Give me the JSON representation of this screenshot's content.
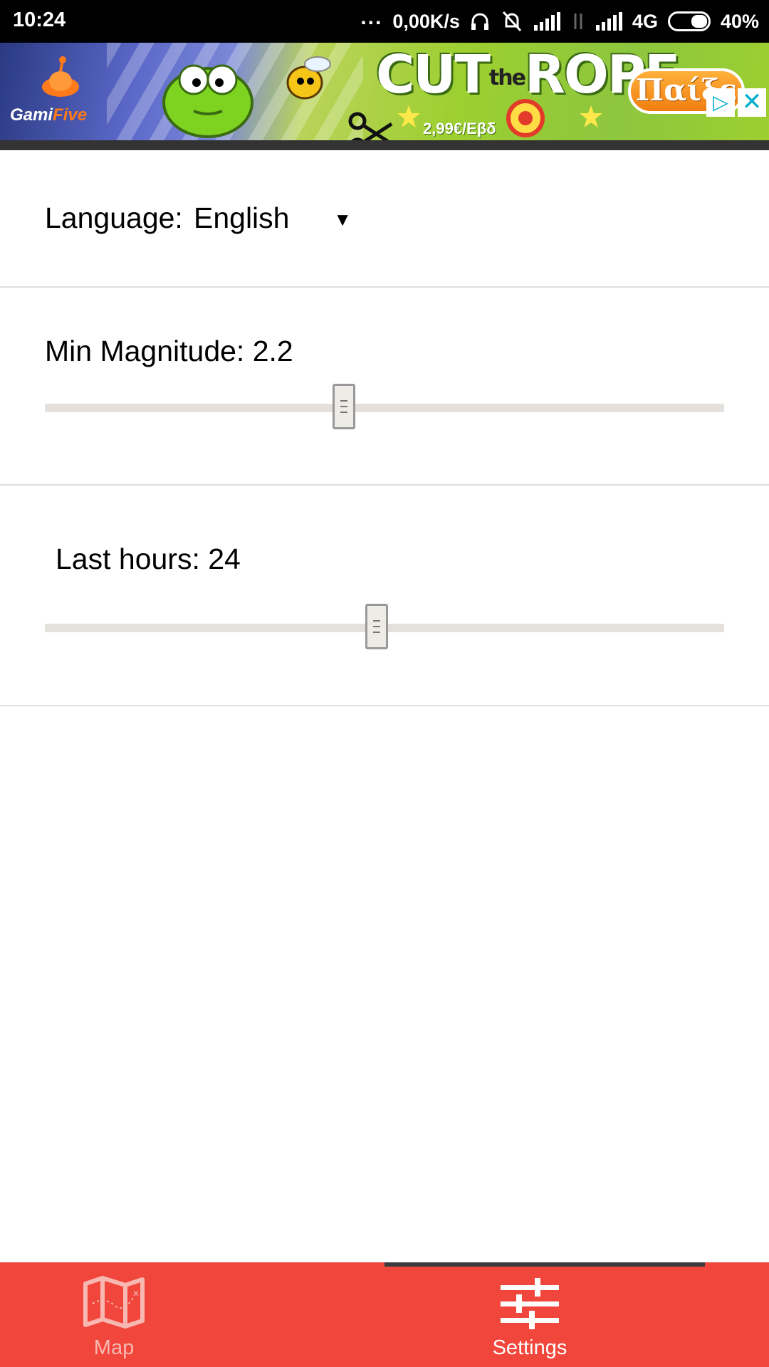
{
  "status_bar": {
    "time": "10:24",
    "dots": "...",
    "network_speed": "0,00K/s",
    "network_type": "4G",
    "battery": "40%",
    "battery_level": 0.4
  },
  "ad": {
    "brand_prefix": "Gami",
    "brand_suffix": "Five",
    "title_left": "CUT",
    "title_the": "the",
    "title_right": "ROPE",
    "price": "2,99€/Εβδ",
    "cta_label": "Παίξε",
    "choices_icon": "ad-choices-icon",
    "close_icon": "close-icon"
  },
  "settings": {
    "language": {
      "label": "Language:",
      "value": "English",
      "arrow": "▼"
    },
    "magnitude": {
      "label": "Min Magnitude: 2.2",
      "value": 2.2,
      "fraction": 0.44
    },
    "hours": {
      "label": "Last hours: 24",
      "value": 24,
      "fraction": 0.488
    }
  },
  "bottom_nav": {
    "items": [
      {
        "label": "Map",
        "icon": "map-icon",
        "active": false
      },
      {
        "label": "Settings",
        "icon": "sliders-icon",
        "active": true
      }
    ]
  },
  "colors": {
    "nav_background": "#f1463b",
    "status_bar": "#000000",
    "active_indicator": "#3c3c3c"
  }
}
